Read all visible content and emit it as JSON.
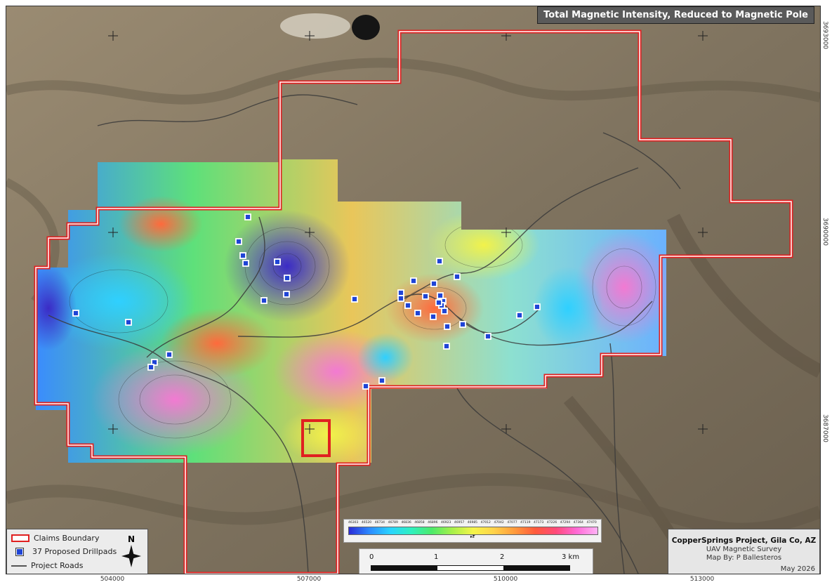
{
  "map": {
    "title": "Total Magnetic Intensity, Reduced to Magnetic Pole",
    "colors": {
      "claims_boundary": "#e02020",
      "drillpad_fill": "#1f44d6",
      "roads": "#4a4a4a",
      "basemap": "#8a7c66"
    },
    "easting_labels": [
      "504000",
      "507000",
      "510000",
      "513000"
    ],
    "northing_labels": [
      "3693000",
      "3690000",
      "3687000"
    ]
  },
  "legend": {
    "claims_label": "Claims Boundary",
    "drillpads_label": "37 Proposed Drillpads",
    "roads_label": "Project Roads",
    "north_label": "N"
  },
  "colorbar": {
    "unit": "nT",
    "ticks": [
      "46303",
      "46520",
      "46734",
      "46789",
      "46836",
      "46858",
      "46896",
      "46923",
      "46957",
      "46985",
      "47012",
      "47042",
      "47077",
      "47119",
      "47173",
      "47226",
      "47294",
      "47364",
      "47470"
    ]
  },
  "scale": {
    "labels": [
      "0",
      "1",
      "2",
      "3 km"
    ]
  },
  "info": {
    "project": "CopperSprings Project, Gila Co, AZ",
    "survey": "UAV Magnetic Survey",
    "author": "Map By: P Ballesteros",
    "date": "May 2026"
  },
  "drillpads": {
    "count": 37
  }
}
